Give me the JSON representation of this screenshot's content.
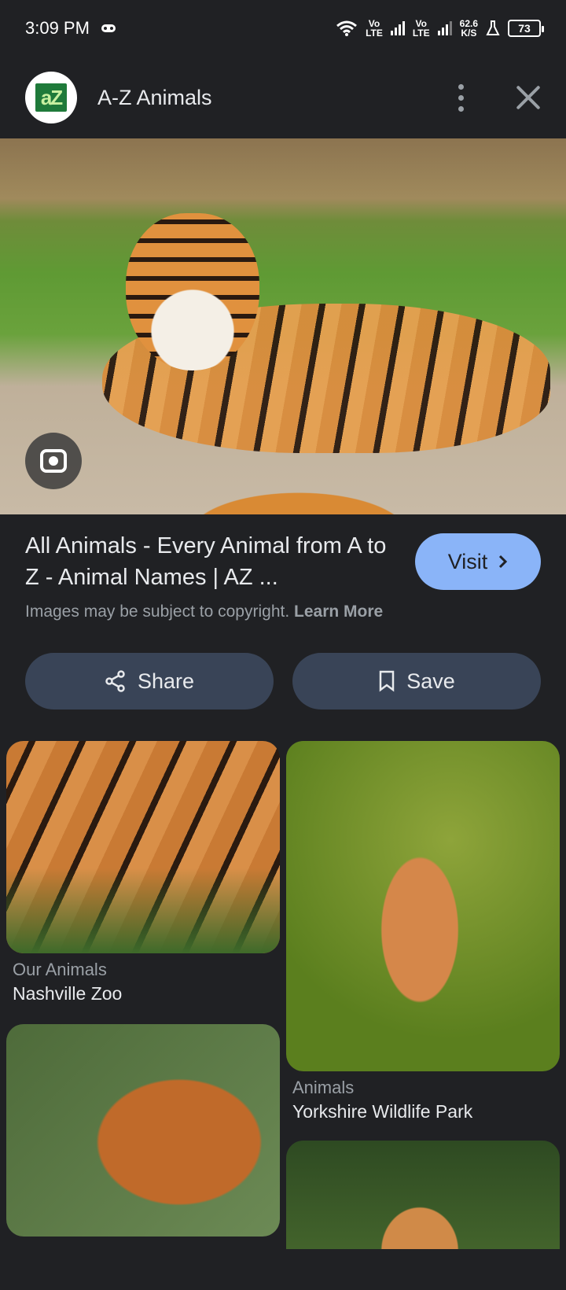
{
  "status_bar": {
    "time": "3:09 PM",
    "net1_top": "Vo",
    "net1_bottom": "LTE",
    "net2_top": "Vo",
    "net2_bottom": "LTE",
    "speed_top": "62.6",
    "speed_bottom": "K/S",
    "battery": "73"
  },
  "header": {
    "logo_text": "aZ",
    "site_name": "A-Z Animals"
  },
  "result": {
    "title": "All Animals - Every Animal from A to Z - Animal Names | AZ ...",
    "visit_label": "Visit",
    "copyright_text": "Images may be subject to copyright.",
    "learn_more": "Learn More"
  },
  "actions": {
    "share_label": "Share",
    "save_label": "Save"
  },
  "related": [
    {
      "title": "Our Animals",
      "source": "Nashville Zoo"
    },
    {
      "title": "Animals",
      "source": "Yorkshire Wildlife Park"
    }
  ],
  "icons": {
    "game": "gamepad-icon",
    "wifi": "wifi-icon",
    "signal": "signal-icon",
    "flask": "flask-icon",
    "battery": "battery-icon",
    "more": "more-vert-icon",
    "close": "close-icon",
    "lens": "lens-icon",
    "share": "share-icon",
    "bookmark": "bookmark-icon",
    "chevron": "chevron-right-icon"
  },
  "colors": {
    "background": "#202124",
    "visit_button": "#8ab4f8",
    "pill_button": "#394457"
  }
}
